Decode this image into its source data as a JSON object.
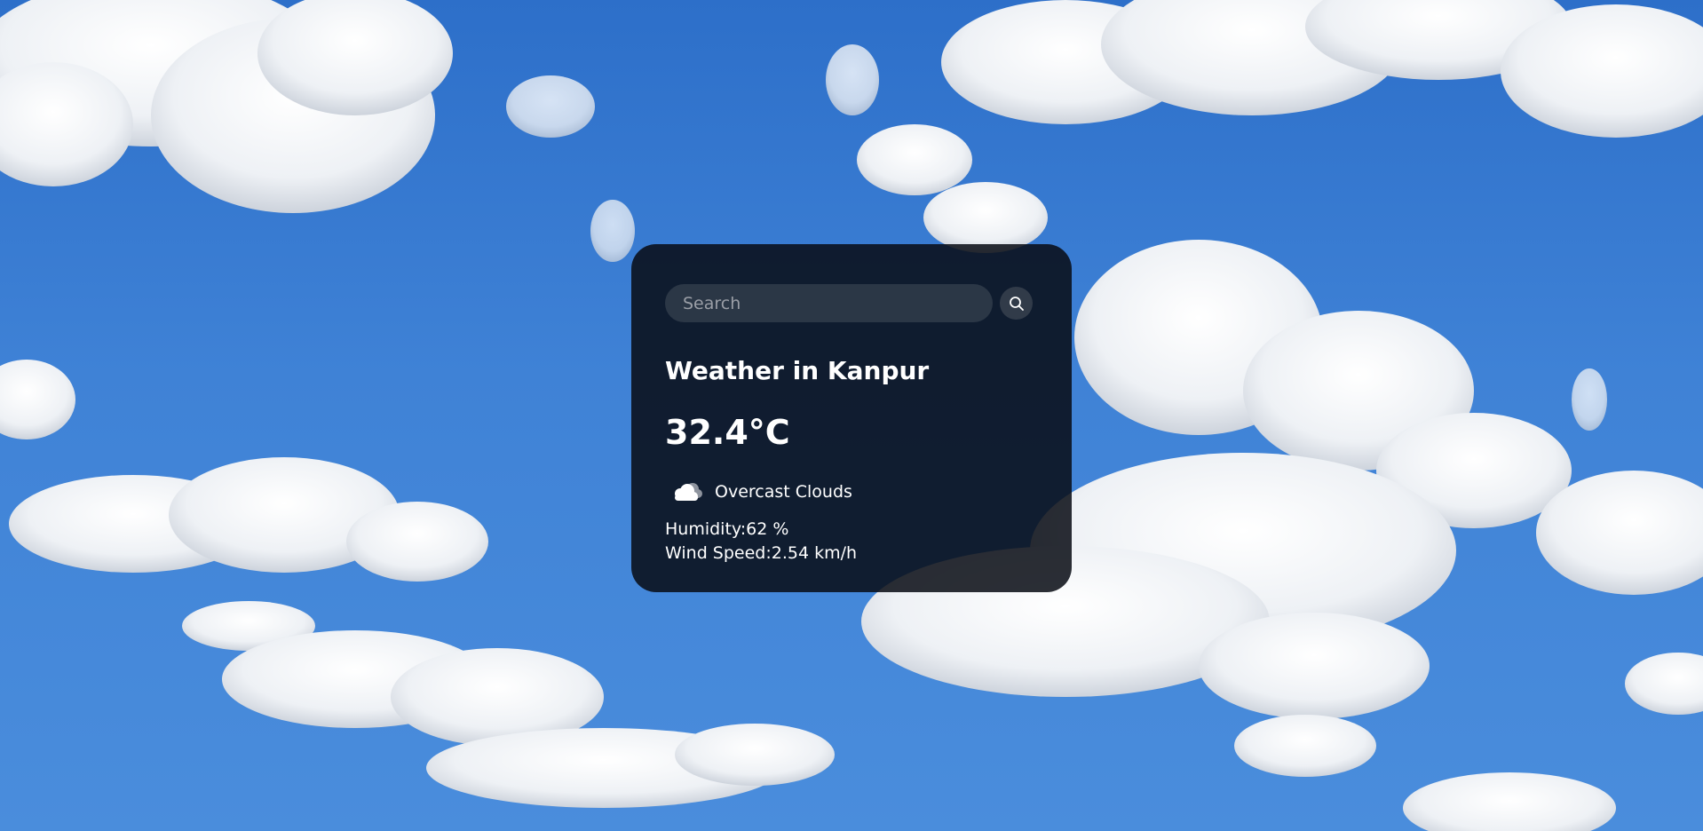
{
  "search": {
    "placeholder": "Search",
    "value": ""
  },
  "weather": {
    "title": "Weather in Kanpur",
    "temperature": "32.4°C",
    "description": "Overcast Clouds",
    "humidity": "Humidity:62 %",
    "wind": "Wind Speed:2.54 km/h"
  },
  "icons": {
    "search": "search-icon",
    "condition": "cloud-icon"
  },
  "colors": {
    "sky": "#3d7bd0",
    "card_bg": "#0b0f16",
    "text": "#ffffff",
    "placeholder": "#9a9ea6"
  }
}
